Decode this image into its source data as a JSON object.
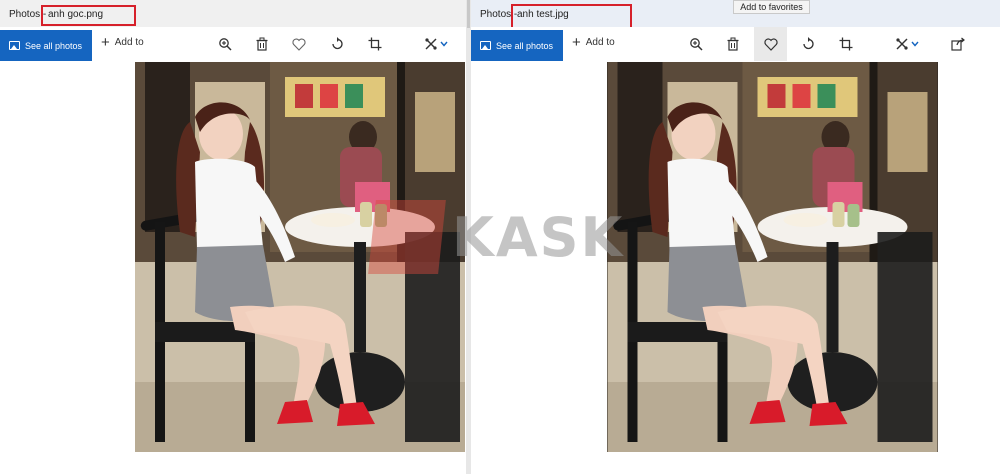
{
  "left_window": {
    "app_title": "Photos - ",
    "file_name": "anh goc.png",
    "toolbar": {
      "see_all_label": "See all photos",
      "add_to_label": "Add to"
    },
    "icons": [
      "zoom-in-icon",
      "delete-icon",
      "favorite-icon",
      "rotate-icon",
      "crop-icon",
      "edit-icon",
      "chevron-down-icon"
    ]
  },
  "right_window": {
    "app_title": "Photos - ",
    "file_name": "anh test.jpg",
    "toolbar": {
      "see_all_label": "See all photos",
      "add_to_label": "Add to"
    },
    "tooltip": "Add to favorites",
    "icons": [
      "zoom-in-icon",
      "delete-icon",
      "favorite-icon",
      "rotate-icon",
      "crop-icon",
      "edit-icon",
      "chevron-down-icon",
      "share-icon"
    ]
  },
  "watermark": "KASK",
  "colors": {
    "accent": "#1565c0",
    "highlight_box": "#d6202a",
    "watermark_red": "#d6463c",
    "shoe_red": "#d81b2a"
  }
}
